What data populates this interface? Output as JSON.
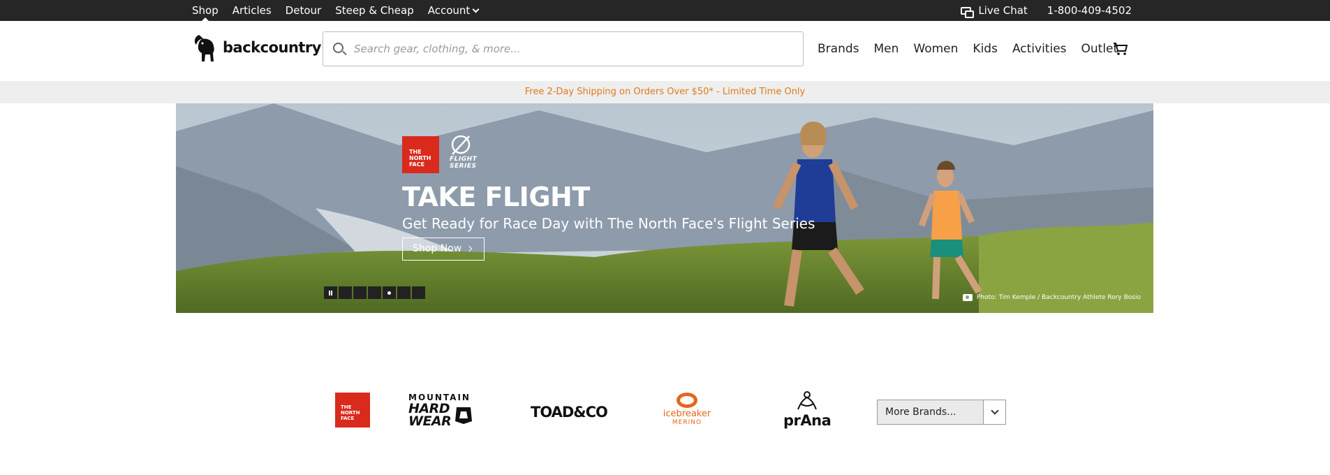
{
  "topbar": {
    "nav": [
      "Shop",
      "Articles",
      "Detour",
      "Steep & Cheap",
      "Account"
    ],
    "live_chat": "Live Chat",
    "phone": "1-800-409-4502"
  },
  "header": {
    "logo_text": "backcountry",
    "search_placeholder": "Search gear, clothing, & more...",
    "nav": [
      "Brands",
      "Men",
      "Women",
      "Kids",
      "Activities",
      "Outlet"
    ]
  },
  "promo": "Free 2-Day Shipping on Orders Over $50* - Limited Time Only",
  "hero": {
    "brand_box": "THE NORTH FACE",
    "flight_text": "FLIGHT SERIES",
    "headline": "TAKE FLIGHT",
    "subheadline": "Get Ready for Race Day with The North Face's Flight Series",
    "cta": "Shop Now",
    "photo_credit": "Photo: Tim Kemple / Backcountry Athlete Rory Bosio",
    "slides": 6,
    "active_slide": 4
  },
  "brands": {
    "tnf": "THE NORTH FACE",
    "mhw_top": "MOUNTAIN",
    "mhw_mid": "HARD",
    "mhw_bot": "WEAR",
    "toad": "TOAD&CO",
    "ice_1": "icebreaker",
    "ice_2": "MERINO",
    "prana": "prAna",
    "select_label": "More Brands..."
  },
  "colors": {
    "topbar": "#262626",
    "promo_text": "#e07a1a",
    "tnf_red": "#d92a1c",
    "icebreaker": "#e8651a"
  }
}
